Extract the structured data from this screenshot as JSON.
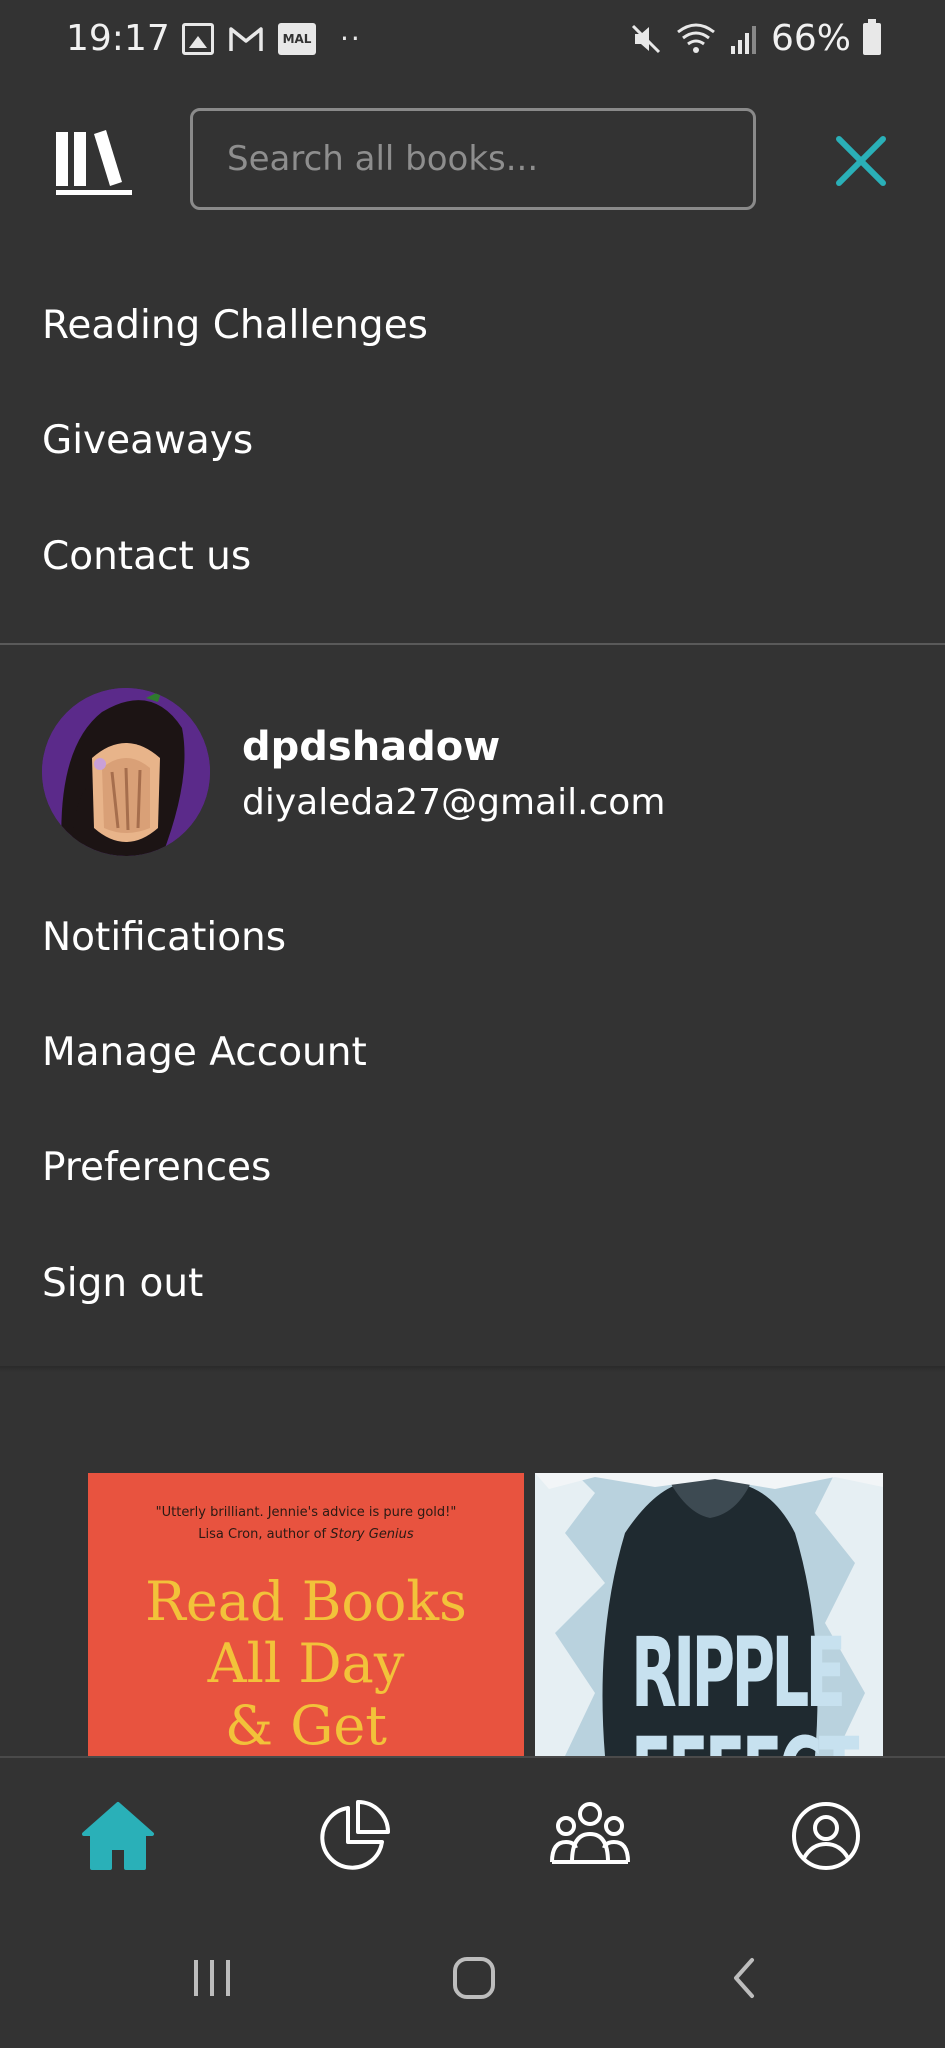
{
  "status_bar": {
    "time": "19:17",
    "mal_label": "MAL",
    "dots": "··",
    "battery": "66%"
  },
  "header": {
    "search_placeholder": "Search all books...",
    "accent_color": "#2ab0b8"
  },
  "menu_top": [
    {
      "label": "Reading Challenges"
    },
    {
      "label": "Giveaways"
    },
    {
      "label": "Contact us"
    }
  ],
  "profile": {
    "username": "dpdshadow",
    "email": "diyaleda27@gmail.com"
  },
  "menu_account": [
    {
      "label": "Notifications"
    },
    {
      "label": "Manage Account"
    },
    {
      "label": "Preferences"
    },
    {
      "label": "Sign out"
    }
  ],
  "books": [
    {
      "quote": "\"Utterly brilliant. Jennie's advice is pure gold!\"",
      "author_line": "Lisa Cron, author of ",
      "author_book": "Story Genius",
      "title_lines": [
        "Read Books",
        "All Day",
        "& Get"
      ]
    },
    {
      "title_lines": [
        "RIPPLE",
        "EFFECT"
      ]
    }
  ],
  "bottom_nav": {
    "items": [
      "home-icon",
      "stats-icon",
      "community-icon",
      "profile-icon"
    ],
    "active": "home-icon"
  }
}
